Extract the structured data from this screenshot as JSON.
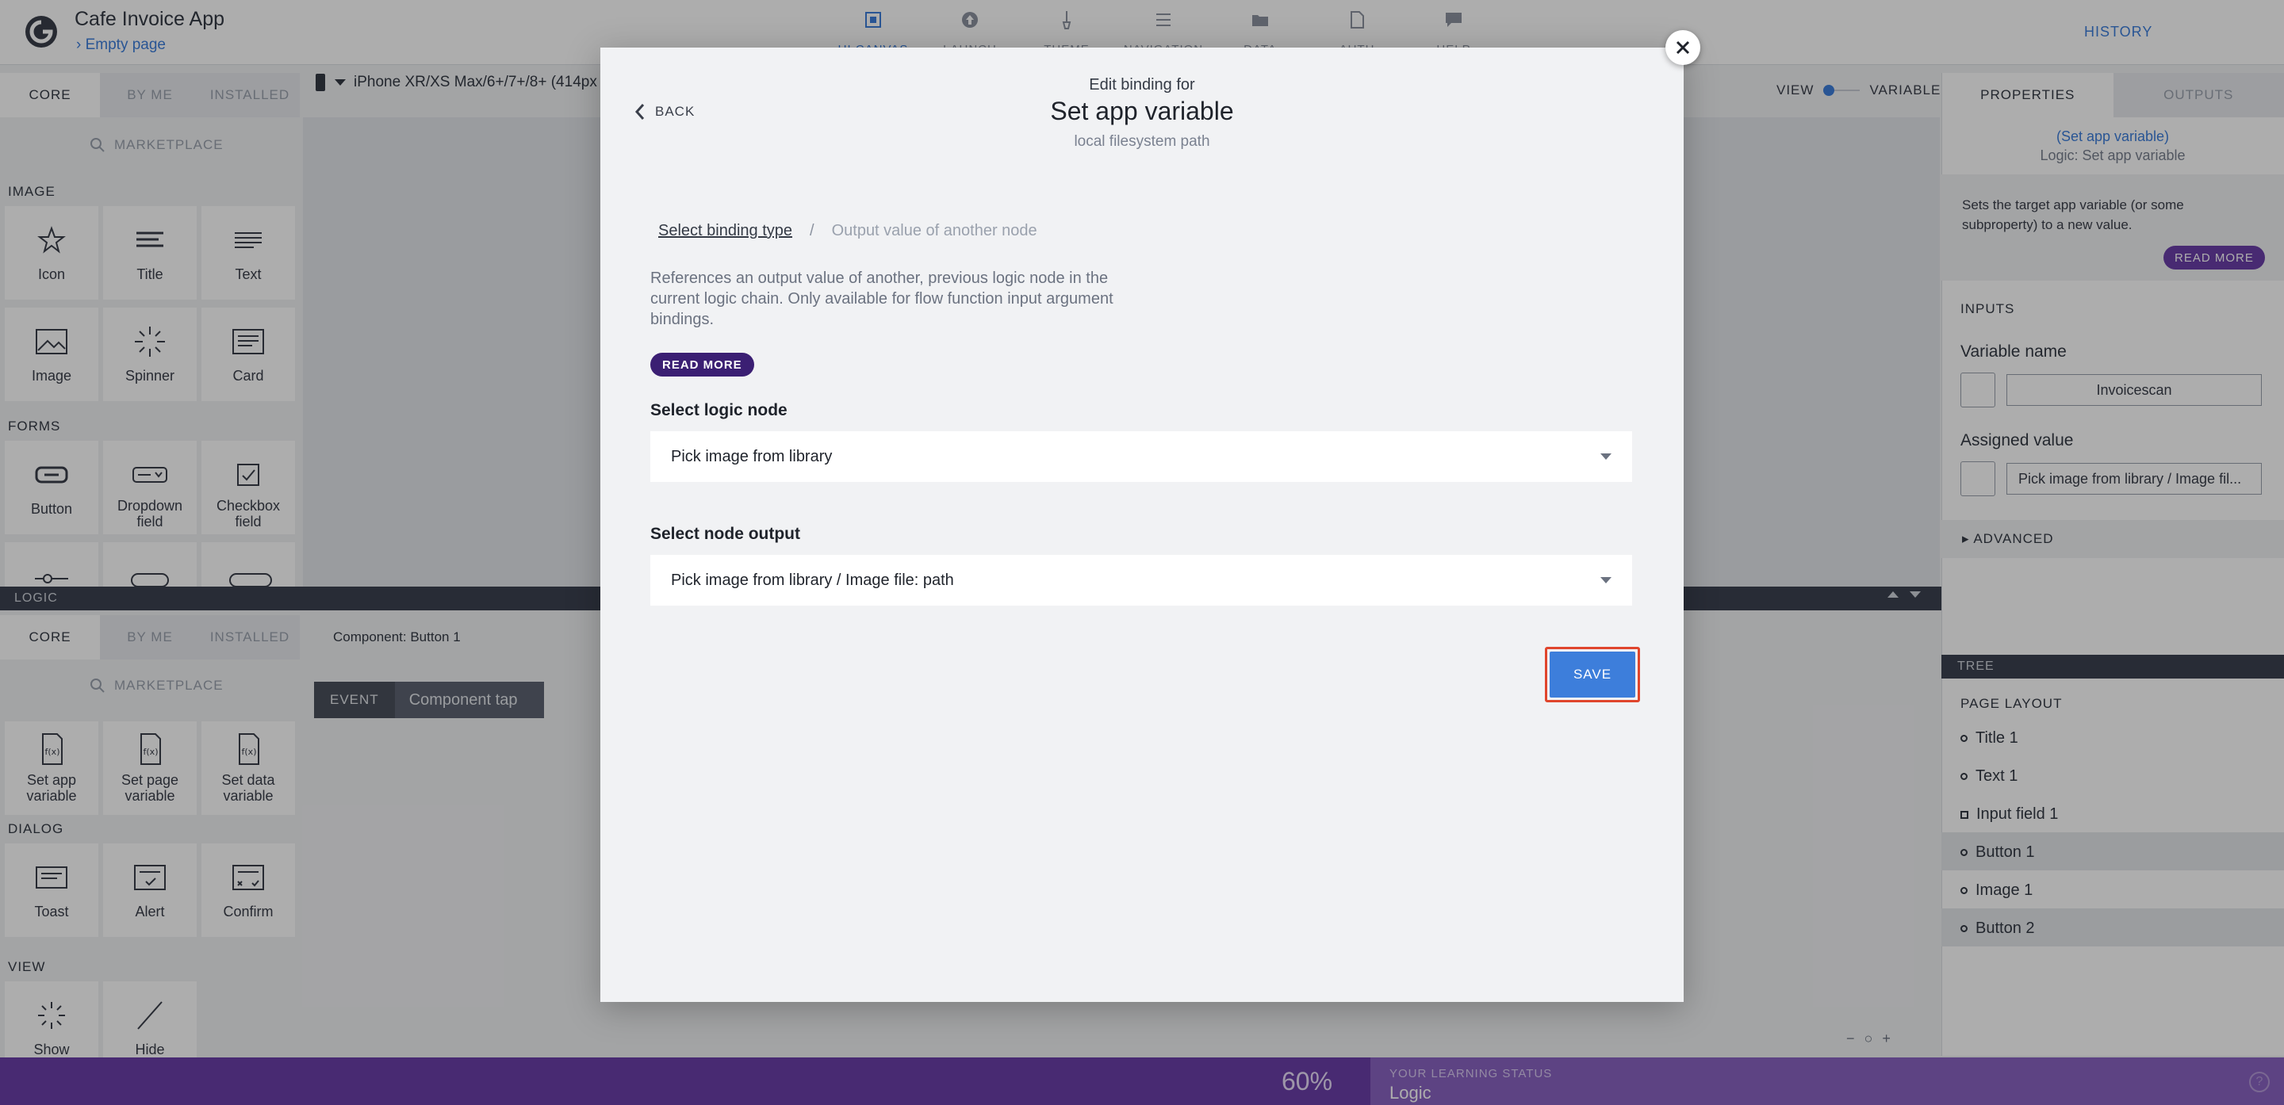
{
  "app": {
    "title": "Cafe Invoice App",
    "page": "Empty page",
    "history": "HISTORY"
  },
  "nav": [
    "UI CANVAS",
    "LAUNCH",
    "THEME",
    "NAVIGATION",
    "DATA",
    "AUTH",
    "HELP"
  ],
  "left_tabs": [
    "CORE",
    "BY ME",
    "INSTALLED"
  ],
  "marketplace": "MARKETPLACE",
  "sections": {
    "image": "IMAGE",
    "forms": "FORMS",
    "dialog": "DIALOG",
    "view": "VIEW"
  },
  "image_tiles": [
    "Icon",
    "Title",
    "Text",
    "Image",
    "Spinner",
    "Card"
  ],
  "form_tiles": [
    "Button",
    "Dropdown field",
    "Checkbox field"
  ],
  "logic_tiles": [
    "Set app variable",
    "Set page variable",
    "Set data variable"
  ],
  "dialog_tiles": [
    "Toast",
    "Alert",
    "Confirm"
  ],
  "view_tiles": [
    "Show",
    "Hide"
  ],
  "device": "iPhone XR/XS Max/6+/7+/8+ (414px",
  "view_toggle": {
    "view": "VIEW",
    "variables": "VARIABLES"
  },
  "logic_panel": {
    "label": "LOGIC",
    "component": "Component: Button 1",
    "event": "EVENT",
    "event_name": "Component tap"
  },
  "right_tabs": [
    "PROPERTIES",
    "OUTPUTS"
  ],
  "properties": {
    "node_link": "(Set app variable)",
    "node_type": "Logic: Set app variable",
    "description": "Sets the target app variable (or some subproperty) to a new value.",
    "read_more": "READ MORE",
    "inputs": "INPUTS",
    "var_name_label": "Variable name",
    "var_name_value": "Invoicescan",
    "assigned_label": "Assigned value",
    "assigned_value": "Pick image from library / Image fil...",
    "advanced": "ADVANCED"
  },
  "tree": {
    "label": "TREE",
    "heading": "PAGE LAYOUT",
    "items": [
      "Title 1",
      "Text 1",
      "Input field 1",
      "Button 1",
      "Image 1",
      "Button 2"
    ]
  },
  "learning": {
    "progress": "60%",
    "label": "YOUR LEARNING STATUS",
    "value": "Logic"
  },
  "modal": {
    "back": "BACK",
    "subtitle": "Edit binding for",
    "title": "Set app variable",
    "hint": "local filesystem path",
    "crumb_link": "Select binding type",
    "crumb_sep": "/",
    "crumb_current": "Output value of another node",
    "description": "References an output value of another, previous logic node in the current logic chain. Only available for flow function input argument bindings.",
    "read_more": "READ MORE",
    "logic_node_label": "Select logic node",
    "logic_node_value": "Pick image from library",
    "node_output_label": "Select node output",
    "node_output_value": "Pick image from library / Image file: path",
    "save": "SAVE"
  }
}
